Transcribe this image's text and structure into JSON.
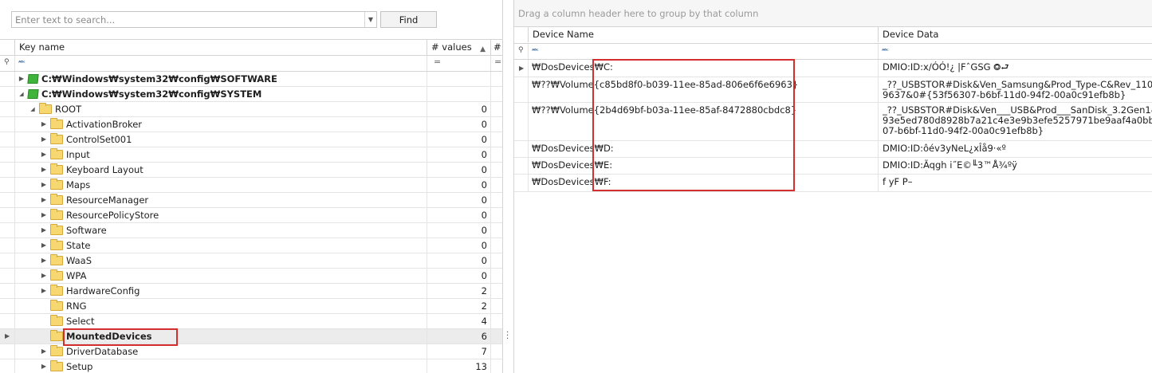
{
  "search": {
    "placeholder": "Enter text to search...",
    "value": "",
    "find_label": "Find"
  },
  "left_grid": {
    "columns": [
      "Key name",
      "# values",
      "#"
    ],
    "rows": [
      {
        "label": "C:₩Windows₩system32₩config₩SOFTWARE",
        "count": "",
        "icon": "hive-icon",
        "expander": "▶",
        "bold": true
      },
      {
        "label": "C:₩Windows₩system32₩config₩SYSTEM",
        "count": "",
        "icon": "hive-icon",
        "expander": "◢",
        "bold": true
      },
      {
        "label": "ROOT",
        "count": "0",
        "icon": "folder-icon",
        "expander": "◢",
        "bold": false
      },
      {
        "label": "ActivationBroker",
        "count": "0",
        "icon": "folder-icon",
        "expander": "▶",
        "bold": false
      },
      {
        "label": "ControlSet001",
        "count": "0",
        "icon": "folder-icon",
        "expander": "▶",
        "bold": false
      },
      {
        "label": "Input",
        "count": "0",
        "icon": "folder-icon",
        "expander": "▶",
        "bold": false
      },
      {
        "label": "Keyboard Layout",
        "count": "0",
        "icon": "folder-icon",
        "expander": "▶",
        "bold": false
      },
      {
        "label": "Maps",
        "count": "0",
        "icon": "folder-icon",
        "expander": "▶",
        "bold": false
      },
      {
        "label": "ResourceManager",
        "count": "0",
        "icon": "folder-icon",
        "expander": "▶",
        "bold": false
      },
      {
        "label": "ResourcePolicyStore",
        "count": "0",
        "icon": "folder-icon",
        "expander": "▶",
        "bold": false
      },
      {
        "label": "Software",
        "count": "0",
        "icon": "folder-icon",
        "expander": "▶",
        "bold": false
      },
      {
        "label": "State",
        "count": "0",
        "icon": "folder-icon",
        "expander": "▶",
        "bold": false
      },
      {
        "label": "WaaS",
        "count": "0",
        "icon": "folder-icon",
        "expander": "▶",
        "bold": false
      },
      {
        "label": "WPA",
        "count": "0",
        "icon": "folder-icon",
        "expander": "▶",
        "bold": false
      },
      {
        "label": "HardwareConfig",
        "count": "2",
        "icon": "folder-icon",
        "expander": "▶",
        "bold": false
      },
      {
        "label": "RNG",
        "count": "2",
        "icon": "folder-icon",
        "expander": "",
        "bold": false
      },
      {
        "label": "Select",
        "count": "4",
        "icon": "folder-icon",
        "expander": "",
        "bold": false
      },
      {
        "label": "MountedDevices",
        "count": "6",
        "icon": "folder-icon",
        "expander": "",
        "bold": true,
        "selected": true
      },
      {
        "label": "DriverDatabase",
        "count": "7",
        "icon": "folder-icon",
        "expander": "▶",
        "bold": false
      },
      {
        "label": "Setup",
        "count": "13",
        "icon": "folder-icon",
        "expander": "▶",
        "bold": false
      }
    ]
  },
  "right_grid": {
    "group_hint": "Drag a column header here to group by that column",
    "columns": [
      "Device Name",
      "Device Data"
    ],
    "rows": [
      {
        "name_lines": [
          "₩DosDevices₩C:"
        ],
        "data_lines": [
          "DMIO:ID:x/ÓÓ!¿ |FˆGSG ⭗⮐"
        ]
      },
      {
        "name_lines": [
          "₩??₩Volume{c85bd8f0-b039-11ee-85ad-806e6f6e6963}"
        ],
        "data_lines": [
          "_??_USBSTOR#Disk&Ven_Samsung&Prod_Type-C&Rev_1100",
          "9637&0#{53f56307-b6bf-11d0-94f2-00a0c91efb8b}"
        ]
      },
      {
        "name_lines": [
          "₩??₩Volume{2b4d69bf-b03a-11ee-85af-8472880cbdc8}"
        ],
        "data_lines": [
          "_??_USBSTOR#Disk&Ven___USB&Prod___SanDisk_3.2Gen1&Re",
          "93e5ed780d8928b7a21c4e3e9b3efe5257971be9aaf4a0bb3c",
          "07-b6bf-11d0-94f2-00a0c91efb8b}"
        ]
      },
      {
        "name_lines": [
          "₩DosDevices₩D:"
        ],
        "data_lines": [
          "DMIO:ID:ôév3yNeL¿xÎå9·«º"
        ]
      },
      {
        "name_lines": [
          "₩DosDevices₩E:"
        ],
        "data_lines": [
          "DMIO:ID:Ãqgh  i˝E©╙3™Å¾ºÿ"
        ]
      },
      {
        "name_lines": [
          "₩DosDevices₩F:"
        ],
        "data_lines": [
          "f yF   P–"
        ]
      }
    ]
  }
}
